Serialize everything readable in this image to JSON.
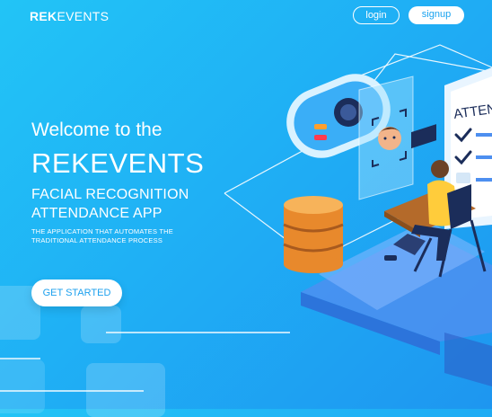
{
  "header": {
    "brand_bold": "REK",
    "brand_regular": "EVENTS",
    "login_label": "login",
    "signup_label": "signup"
  },
  "hero": {
    "welcome": "Welcome to the",
    "title": "REKEVENTS",
    "subtitle_line1": "FACIAL RECOGNITION",
    "subtitle_line2": "ATTENDANCE APP",
    "desc_line1": "THE APPLICATION THAT AUTOMATES THE",
    "desc_line2": "TRADITIONAL ATTENDANCE PROCESS",
    "cta_label": "GET STARTED"
  },
  "illustration": {
    "board_text": "ATTEN"
  },
  "colors": {
    "background": "#1fb0f5",
    "cta_text": "#1ea1ee",
    "accent_red": "#ff3b4f",
    "accent_orange": "#ff9f2e"
  }
}
